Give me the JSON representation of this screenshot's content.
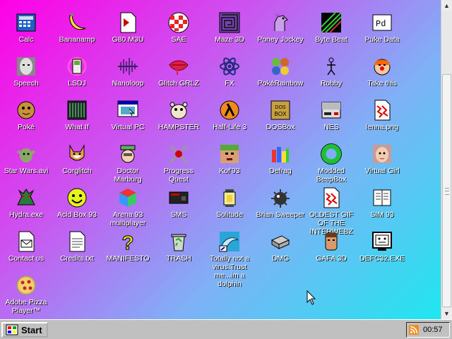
{
  "desktop": {
    "icons": [
      {
        "label": "Calc",
        "icon": "calculator-icon"
      },
      {
        "label": "Bananamp",
        "icon": "banana-icon"
      },
      {
        "label": "G80.M3U",
        "icon": "playlist-file-icon"
      },
      {
        "label": "SAE",
        "icon": "amiga-ball-icon"
      },
      {
        "label": "Maze 3D",
        "icon": "maze-icon"
      },
      {
        "label": "Poney Jockey",
        "icon": "pony-icon"
      },
      {
        "label": "Byte Beat",
        "icon": "bytebeat-icon"
      },
      {
        "label": "Puke Data",
        "icon": "pd-icon"
      },
      {
        "label": "Speech",
        "icon": "face-icon"
      },
      {
        "label": "LSDJ",
        "icon": "gameboy-icon"
      },
      {
        "label": "Nanoloop",
        "icon": "waveform-icon"
      },
      {
        "label": "Glitch GRLZ",
        "icon": "lips-icon"
      },
      {
        "label": "FX",
        "icon": "atom-icon"
      },
      {
        "label": "PokéRainbow",
        "icon": "pokemon-icon"
      },
      {
        "label": "Robby",
        "icon": "stick-figure-icon"
      },
      {
        "label": "Take this",
        "icon": "clown-icon"
      },
      {
        "label": "Poké",
        "icon": "poke-icon"
      },
      {
        "label": "What If",
        "icon": "terminal-grid-icon"
      },
      {
        "label": "Virtual PC",
        "icon": "virtual-pc-icon"
      },
      {
        "label": "HAMPSTER",
        "icon": "hamster-icon"
      },
      {
        "label": "Half-Life 3",
        "icon": "lambda-icon"
      },
      {
        "label": "DOSBox",
        "icon": "dosbox-icon"
      },
      {
        "label": "NES",
        "icon": "nes-icon"
      },
      {
        "label": "lenna.png",
        "icon": "image-file-icon"
      },
      {
        "label": "Star Wars.avi",
        "icon": "yoda-icon"
      },
      {
        "label": "Corglitch",
        "icon": "corgi-icon"
      },
      {
        "label": "Doctor Marburg",
        "icon": "doctor-icon"
      },
      {
        "label": "Progress Quest",
        "icon": "crossed-swords-icon"
      },
      {
        "label": "Kof'93",
        "icon": "fighter-icon"
      },
      {
        "label": "Defrag",
        "icon": "defrag-icon"
      },
      {
        "label": "Modded BeepBox",
        "icon": "green-ring-icon"
      },
      {
        "label": "Virtual Girl",
        "icon": "girl-face-icon"
      },
      {
        "label": "Hydra.exe",
        "icon": "hydra-icon"
      },
      {
        "label": "Acid Box 93",
        "icon": "smiley-icon"
      },
      {
        "label": "Arena 93 multiplayer",
        "icon": "cube-icon"
      },
      {
        "label": "SMS",
        "icon": "sms-console-icon"
      },
      {
        "label": "Solitude",
        "icon": "lantern-icon"
      },
      {
        "label": "Brian Sweeper",
        "icon": "mine-icon"
      },
      {
        "label": "OLDEST GIF OF THE INTERWEBZ",
        "icon": "image-file-icon"
      },
      {
        "label": "SIM 93",
        "icon": "book-icon"
      },
      {
        "label": "Contact us",
        "icon": "mail-file-icon"
      },
      {
        "label": "Credits.txt",
        "icon": "text-file-icon"
      },
      {
        "label": "MANIFESTO",
        "icon": "question-mark-icon"
      },
      {
        "label": "TRASH",
        "icon": "recycle-bin-icon"
      },
      {
        "label": "Totally not a virus.Trust me...im a dolphin",
        "icon": "dolphin-icon"
      },
      {
        "label": "DMG",
        "icon": "dmg-icon"
      },
      {
        "label": "GAFA 3D",
        "icon": "head-icon"
      },
      {
        "label": "DEFC32.EXE",
        "icon": "computer-face-icon"
      },
      {
        "label": "Adobe Pizza Player™",
        "icon": "pizza-icon"
      }
    ]
  },
  "taskbar": {
    "start_label": "Start",
    "clock": "00:57",
    "tray_icon": "rss-icon"
  },
  "colors": {
    "gradient_top_left": "#ff00e6",
    "gradient_bottom_right": "#1ee7ef",
    "taskbar": "#c0c0c0",
    "label_text": "#ffffff"
  }
}
